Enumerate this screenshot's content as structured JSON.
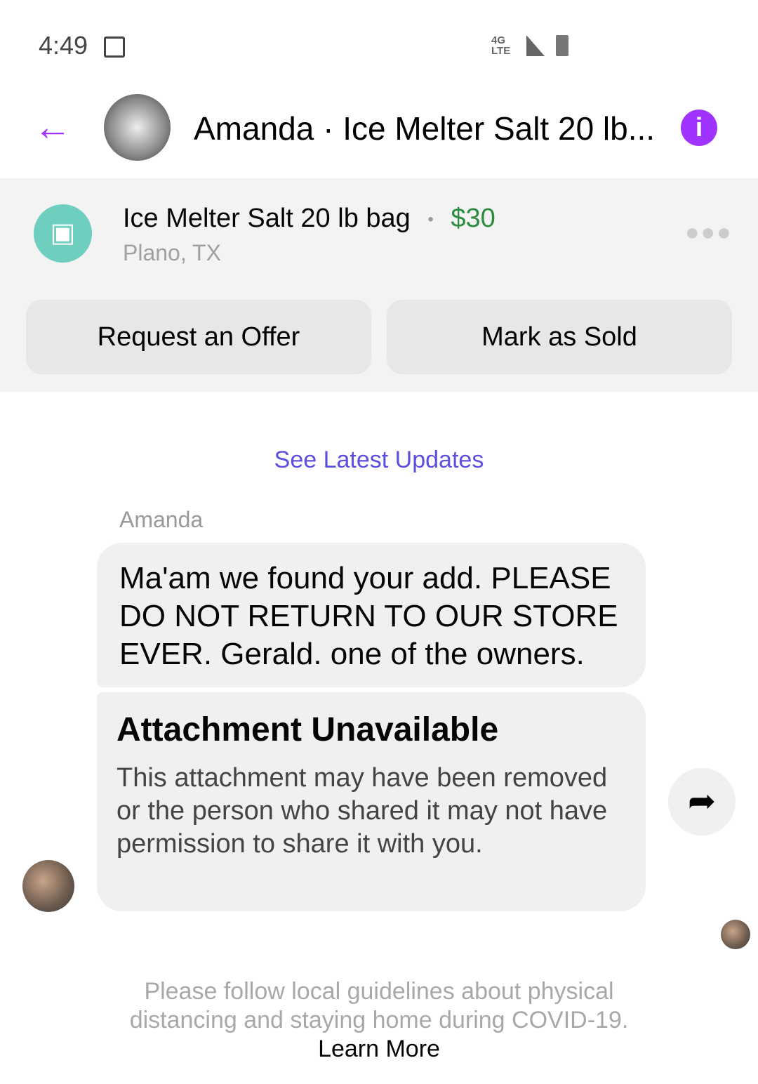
{
  "status": {
    "time": "4:49",
    "network": "4G LTE"
  },
  "header": {
    "title": "Amanda · Ice Melter Salt 20 lb...",
    "accent": "#a033ff"
  },
  "listing": {
    "title": "Ice Melter Salt 20 lb bag",
    "separator": "•",
    "price": "$30",
    "price_color": "#2e8b3d",
    "location": "Plano, TX",
    "icon_color": "#6fcfbf"
  },
  "actions": {
    "request_offer": "Request an Offer",
    "mark_sold": "Mark as Sold"
  },
  "updates_link": "See Latest Updates",
  "messages": [
    {
      "sender": "Amanda",
      "text": "Ma'am we found your add. PLEASE DO NOT RETURN TO OUR STORE EVER. Gerald. one of the owners."
    },
    {
      "title": "Attachment Unavailable",
      "text": "This attachment may have been removed or the person who shared it may not have permission to share it with you."
    }
  ],
  "footer": {
    "text": "Please follow local guidelines about physical distancing and staying home during COVID-19.",
    "link": "Learn More"
  }
}
